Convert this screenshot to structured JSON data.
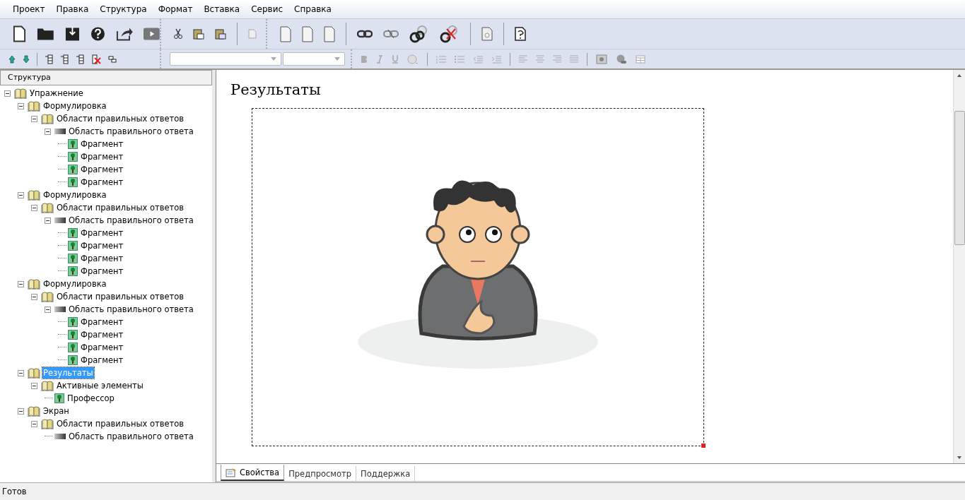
{
  "menu": [
    "Проект",
    "Правка",
    "Структура",
    "Формат",
    "Вставка",
    "Сервис",
    "Справка"
  ],
  "structure_panel": {
    "title": "Структура",
    "tree": [
      {
        "label": "Упражнение",
        "kind": "folder",
        "expanded": true,
        "selected": false,
        "children": [
          {
            "label": "Формулировка",
            "kind": "folder",
            "expanded": true,
            "selected": false,
            "children": [
              {
                "label": "Области правильных ответов",
                "kind": "folder",
                "expanded": true,
                "selected": false,
                "children": [
                  {
                    "label": "Область правильного ответа",
                    "kind": "area",
                    "expanded": true,
                    "selected": false,
                    "children": [
                      {
                        "label": "Фрагмент",
                        "kind": "fragment",
                        "selected": false
                      },
                      {
                        "label": "Фрагмент",
                        "kind": "fragment",
                        "selected": false
                      },
                      {
                        "label": "Фрагмент",
                        "kind": "fragment",
                        "selected": false
                      },
                      {
                        "label": "Фрагмент",
                        "kind": "fragment",
                        "selected": false
                      }
                    ]
                  }
                ]
              }
            ]
          },
          {
            "label": "Формулировка",
            "kind": "folder",
            "expanded": true,
            "selected": false,
            "children": [
              {
                "label": "Области правильных ответов",
                "kind": "folder",
                "expanded": true,
                "selected": false,
                "children": [
                  {
                    "label": "Область правильного ответа",
                    "kind": "area",
                    "expanded": true,
                    "selected": false,
                    "children": [
                      {
                        "label": "Фрагмент",
                        "kind": "fragment",
                        "selected": false
                      },
                      {
                        "label": "Фрагмент",
                        "kind": "fragment",
                        "selected": false
                      },
                      {
                        "label": "Фрагмент",
                        "kind": "fragment",
                        "selected": false
                      },
                      {
                        "label": "Фрагмент",
                        "kind": "fragment",
                        "selected": false
                      }
                    ]
                  }
                ]
              }
            ]
          },
          {
            "label": "Формулировка",
            "kind": "folder",
            "expanded": true,
            "selected": false,
            "children": [
              {
                "label": "Области правильных ответов",
                "kind": "folder",
                "expanded": true,
                "selected": false,
                "children": [
                  {
                    "label": "Область правильного ответа",
                    "kind": "area",
                    "expanded": true,
                    "selected": false,
                    "children": [
                      {
                        "label": "Фрагмент",
                        "kind": "fragment",
                        "selected": false
                      },
                      {
                        "label": "Фрагмент",
                        "kind": "fragment",
                        "selected": false
                      },
                      {
                        "label": "Фрагмент",
                        "kind": "fragment",
                        "selected": false
                      },
                      {
                        "label": "Фрагмент",
                        "kind": "fragment",
                        "selected": false
                      }
                    ]
                  }
                ]
              }
            ]
          },
          {
            "label": "Результаты",
            "kind": "folder",
            "expanded": true,
            "selected": true,
            "children": [
              {
                "label": "Активные элементы",
                "kind": "folder",
                "expanded": true,
                "selected": false,
                "children": [
                  {
                    "label": "Профессор",
                    "kind": "fragment",
                    "selected": false
                  }
                ]
              }
            ]
          },
          {
            "label": "Экран",
            "kind": "folder",
            "expanded": true,
            "selected": false,
            "children": [
              {
                "label": "Области правильных ответов",
                "kind": "folder",
                "expanded": true,
                "selected": false,
                "children": [
                  {
                    "label": "Область правильного ответа",
                    "kind": "area",
                    "selected": false
                  }
                ]
              }
            ]
          }
        ]
      }
    ]
  },
  "editor": {
    "heading": "Результаты"
  },
  "bottom_tabs": [
    {
      "label": "Свойства",
      "selected": true
    },
    {
      "label": "Предпросмотр",
      "selected": false
    },
    {
      "label": "Поддержка",
      "selected": false
    }
  ],
  "status_bar": "Готов"
}
